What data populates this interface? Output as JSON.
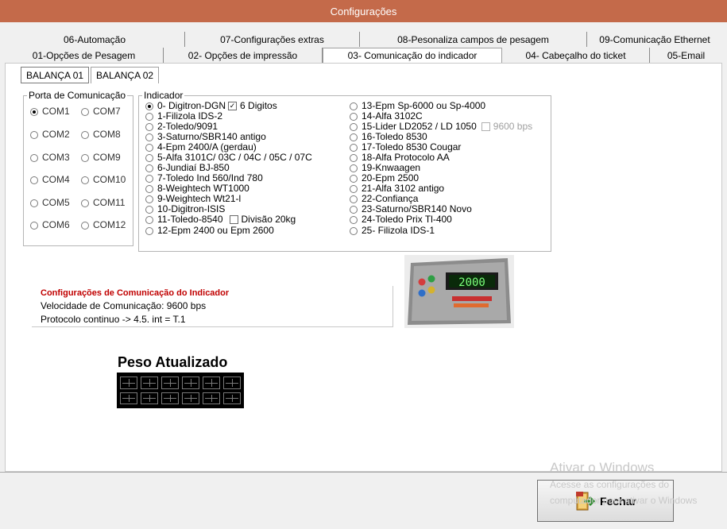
{
  "window": {
    "title": "Configurações"
  },
  "tabs_row1": [
    "06-Automação",
    "07-Configurações extras",
    "08-Pesonaliza campos de pesagem",
    "09-Comunicação Ethernet"
  ],
  "tabs_row2": [
    "01-Opções de Pesagem",
    "02- Opções de impressão",
    "03- Comunicação do indicador",
    "04- Cabeçalho do ticket",
    "05-Email"
  ],
  "active_tab": "03- Comunicação do indicador",
  "subtabs": [
    "BALANÇA 01",
    "BALANÇA 02"
  ],
  "porta": {
    "legend": "Porta de Comunicação",
    "ports": [
      "COM1",
      "COM7",
      "COM2",
      "COM8",
      "COM3",
      "COM9",
      "COM4",
      "COM10",
      "COM5",
      "COM11",
      "COM6",
      "COM12"
    ],
    "selected": "COM1"
  },
  "indicador": {
    "legend": "Indicador",
    "left": [
      "0- Digitron-DGN",
      "1-Filizola IDS-2",
      "2-Toledo/9091",
      "3-Saturno/SBR140 antigo",
      "4-Epm 2400/A  (gerdau)",
      "5-Alfa 3101C/ 03C / 04C / 05C / 07C",
      "6-Jundiaí BJ-850",
      "7-Toledo Ind 560/Ind 780",
      "8-Weightech WT1000",
      "9-Weightech Wt21-l",
      "10-Digitron-ISIS",
      "11-Toledo-8540",
      "12-Epm 2400 ou Epm 2600"
    ],
    "right": [
      "13-Epm Sp-6000 ou Sp-4000",
      "14-Alfa 3102C",
      "15-Lider LD2052 / LD 1050",
      "16-Toledo 8530",
      "17-Toledo 8530 Cougar",
      "18-Alfa Protocolo AA",
      "19-Knwaagen",
      "20-Epm 2500",
      "21-Alfa 3102 antigo",
      "22-Confiança",
      "23-Saturno/SBR140  Novo",
      "24-Toledo Prix Tl-400",
      "25- Filizola IDS-1"
    ],
    "selected": "0- Digitron-DGN",
    "check_6digitos": "6 Digitos",
    "check_divisao": "Divisão 20kg",
    "check_9600": "9600 bps"
  },
  "config": {
    "title": "Configurações de Comunicação do Indicador",
    "velocidade": "Velocidade de Comunicação: 9600 bps",
    "protocolo": "Protocolo continuo -> 4.5. int = T.1"
  },
  "device_display": "2000",
  "peso_title": "Peso Atualizado",
  "watermark": {
    "line1": "Ativar o Windows",
    "line2": "Acesse as configurações do",
    "line3": "computador para ativar o Windows"
  },
  "fechar_label": "Fechar",
  "colors": {
    "titlebar": "#c46a4a",
    "config_title": "#c00000"
  }
}
